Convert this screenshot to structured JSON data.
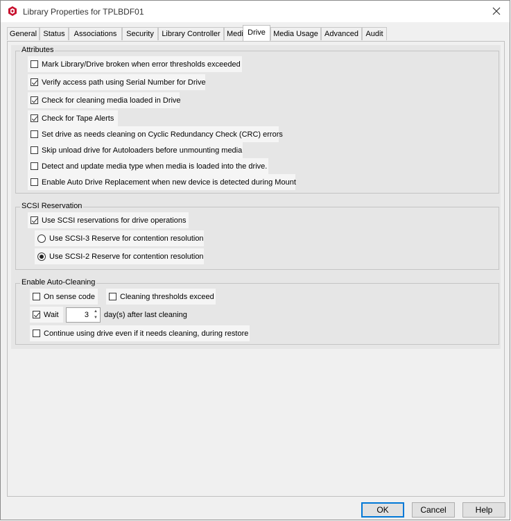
{
  "window": {
    "title": "Library Properties for TPLBDF01"
  },
  "tabs": [
    "General",
    "Status",
    "Associations",
    "Security",
    "Library Controller",
    "Media",
    "Drive",
    "Media Usage",
    "Advanced",
    "Audit"
  ],
  "active_tab": "Drive",
  "attributes": {
    "title": "Attributes",
    "items": [
      {
        "label": "Mark Library/Drive broken when error thresholds exceeded",
        "checked": false
      },
      {
        "label": "Verify access path using Serial Number for Drive",
        "checked": true
      },
      {
        "label": "Check for cleaning media loaded in Drive",
        "checked": true
      },
      {
        "label": "Check for Tape Alerts",
        "checked": true
      },
      {
        "label": "Set drive as needs cleaning on Cyclic Redundancy Check (CRC) errors",
        "checked": false
      },
      {
        "label": "Skip unload drive for Autoloaders before unmounting media",
        "checked": false
      },
      {
        "label": "Detect and update media type when media is loaded into the drive.",
        "checked": false
      },
      {
        "label": "Enable Auto Drive Replacement when new device is detected during Mount",
        "checked": false
      }
    ]
  },
  "scsi": {
    "title": "SCSI Reservation",
    "use_label": "Use SCSI reservations for drive operations",
    "use_checked": true,
    "scsi3_label": "Use SCSI-3 Reserve for contention resolution",
    "scsi2_label": "Use SCSI-2 Reserve for contention resolution",
    "selected": "scsi2"
  },
  "autoclean": {
    "title": "Enable Auto-Cleaning",
    "sense_label": "On sense code",
    "sense_checked": false,
    "threshold_label": "Cleaning thresholds exceed",
    "threshold_checked": false,
    "wait_label": "Wait",
    "wait_checked": true,
    "wait_value": "3",
    "wait_suffix": "day(s) after last cleaning",
    "continue_label": "Continue using drive even if it needs cleaning, during restore",
    "continue_checked": false
  },
  "buttons": {
    "ok": "OK",
    "cancel": "Cancel",
    "help": "Help"
  },
  "colors": {
    "accent": "#0078d7",
    "app_icon": "#c8102e"
  }
}
